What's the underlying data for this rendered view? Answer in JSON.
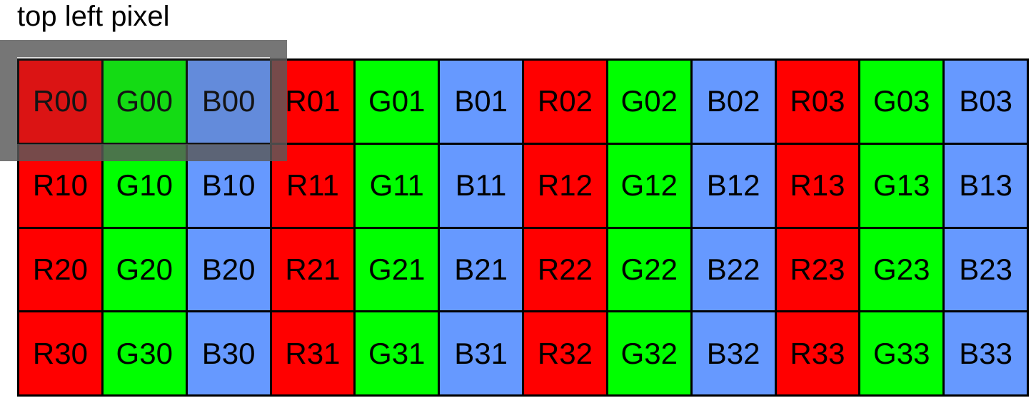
{
  "caption": "top left pixel",
  "colors": {
    "R": "#ff0000",
    "G": "#00ff00",
    "B": "#6699ff",
    "border": "#000000",
    "highlight": "#5a5a5a"
  },
  "grid": {
    "rows": [
      [
        "R00",
        "G00",
        "B00",
        "R01",
        "G01",
        "B01",
        "R02",
        "G02",
        "B02",
        "R03",
        "G03",
        "B03"
      ],
      [
        "R10",
        "G10",
        "B10",
        "R11",
        "G11",
        "B11",
        "R12",
        "G12",
        "B12",
        "R13",
        "G13",
        "B13"
      ],
      [
        "R20",
        "G20",
        "B20",
        "R21",
        "G21",
        "B21",
        "R22",
        "G22",
        "B22",
        "R23",
        "G23",
        "B23"
      ],
      [
        "R30",
        "G30",
        "B30",
        "R31",
        "G31",
        "B31",
        "R32",
        "G32",
        "B32",
        "R33",
        "G33",
        "B33"
      ]
    ]
  }
}
